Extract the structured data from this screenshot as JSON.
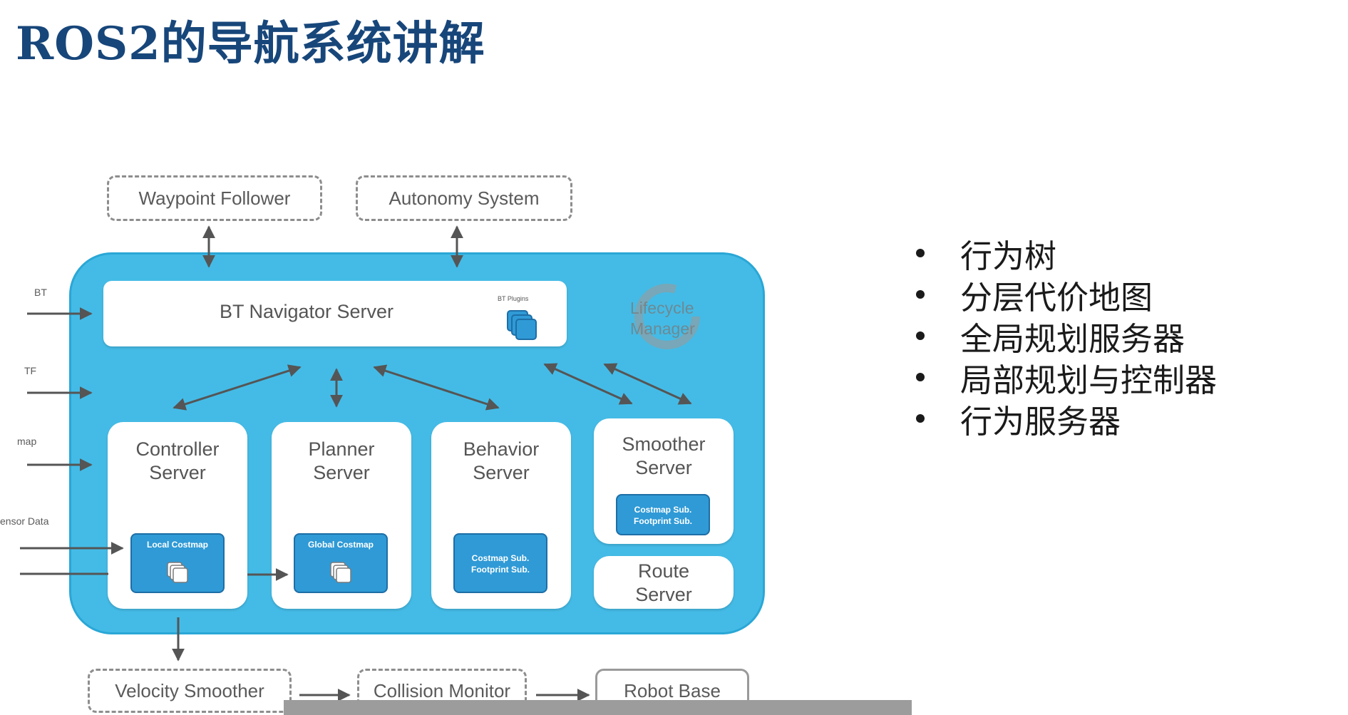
{
  "slide": {
    "title": "ROS2的导航系统讲解"
  },
  "diagram": {
    "top_boxes": {
      "waypoint_follower": "Waypoint Follower",
      "autonomy_system": "Autonomy System"
    },
    "bt_navigator": {
      "label": "BT Navigator Server",
      "plugins_label": "BT Plugins"
    },
    "lifecycle_manager": "Lifecycle\nManager",
    "inputs": {
      "bt": "BT",
      "tf": "TF",
      "map": "map",
      "sensor_data": "ensor Data"
    },
    "servers": {
      "controller": {
        "label": "Controller\nServer",
        "costmap": "Local Costmap"
      },
      "planner": {
        "label": "Planner\nServer",
        "costmap": "Global Costmap"
      },
      "behavior": {
        "label": "Behavior\nServer",
        "costmap": "Costmap Sub.\nFootprint Sub."
      },
      "smoother": {
        "label": "Smoother\nServer",
        "costmap": "Costmap Sub.\nFootprint Sub."
      },
      "route": {
        "label": "Route\nServer"
      }
    },
    "bottom_boxes": {
      "velocity_smoother": "Velocity Smoother",
      "collision_monitor": "Collision Monitor",
      "robot_base": "Robot Base"
    }
  },
  "bullets": [
    "行为树",
    "分层代价地图",
    "全局规划服务器",
    "局部规划与控制器",
    "行为服务器"
  ],
  "colors": {
    "title": "#17467a",
    "container": "#44bbe6",
    "costmap": "#2f9ad6"
  }
}
